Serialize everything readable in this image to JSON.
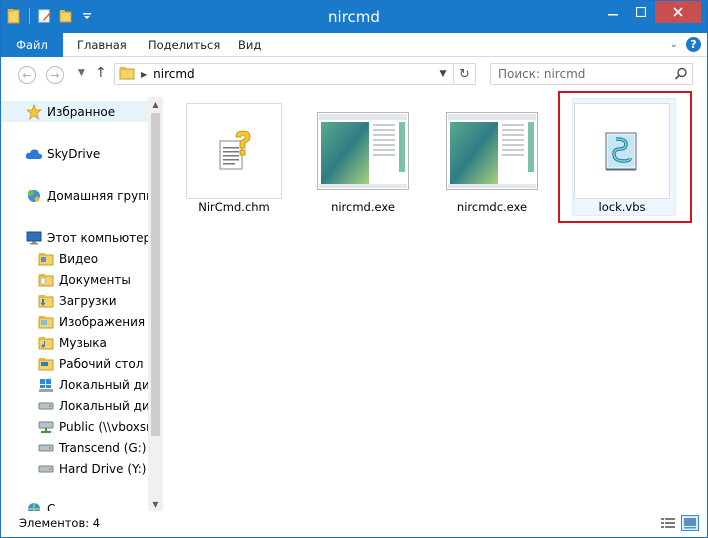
{
  "window": {
    "title": "nircmd"
  },
  "ribbon": {
    "tabs": [
      "Файл",
      "Главная",
      "Поделиться",
      "Вид"
    ]
  },
  "address": {
    "path": [
      "nircmd"
    ],
    "search_placeholder": "Поиск: nircmd"
  },
  "navigation": {
    "items": [
      {
        "label": "Избранное",
        "icon": "star-icon",
        "level": 0,
        "selected": true
      },
      {
        "label": "SkyDrive",
        "icon": "cloud-icon",
        "level": 0
      },
      {
        "label": "Домашняя группа",
        "icon": "homegroup-icon",
        "level": 0
      },
      {
        "label": "Этот компьютер",
        "icon": "computer-icon",
        "level": 0
      },
      {
        "label": "Видео",
        "icon": "folder-icon",
        "level": 1
      },
      {
        "label": "Документы",
        "icon": "folder-icon",
        "level": 1
      },
      {
        "label": "Загрузки",
        "icon": "folder-icon",
        "level": 1
      },
      {
        "label": "Изображения",
        "icon": "folder-icon",
        "level": 1
      },
      {
        "label": "Музыка",
        "icon": "folder-icon",
        "level": 1
      },
      {
        "label": "Рабочий стол",
        "icon": "folder-icon",
        "level": 1
      },
      {
        "label": "Локальный диск",
        "icon": "windows-drive-icon",
        "level": 1
      },
      {
        "label": "Локальный диск",
        "icon": "drive-icon",
        "level": 1
      },
      {
        "label": "Public (\\\\vboxsrv",
        "icon": "network-drive-icon",
        "level": 1
      },
      {
        "label": "Transcend (G:)",
        "icon": "drive-icon",
        "level": 1
      },
      {
        "label": "Hard Drive (Y:)",
        "icon": "drive-icon",
        "level": 1
      },
      {
        "label": "С",
        "icon": "network-icon",
        "level": 0
      }
    ]
  },
  "files": [
    {
      "name": "NirCmd.chm",
      "icon": "help-file-icon"
    },
    {
      "name": "nircmd.exe",
      "icon": "exe-thumbnail-icon"
    },
    {
      "name": "nircmdc.exe",
      "icon": "exe-thumbnail-icon"
    },
    {
      "name": "lock.vbs",
      "icon": "script-file-icon"
    }
  ],
  "status": {
    "text": "Элементов: 4"
  },
  "colors": {
    "accent": "#1979ca",
    "highlight": "#d0161d",
    "selection": "#cce8ff"
  }
}
